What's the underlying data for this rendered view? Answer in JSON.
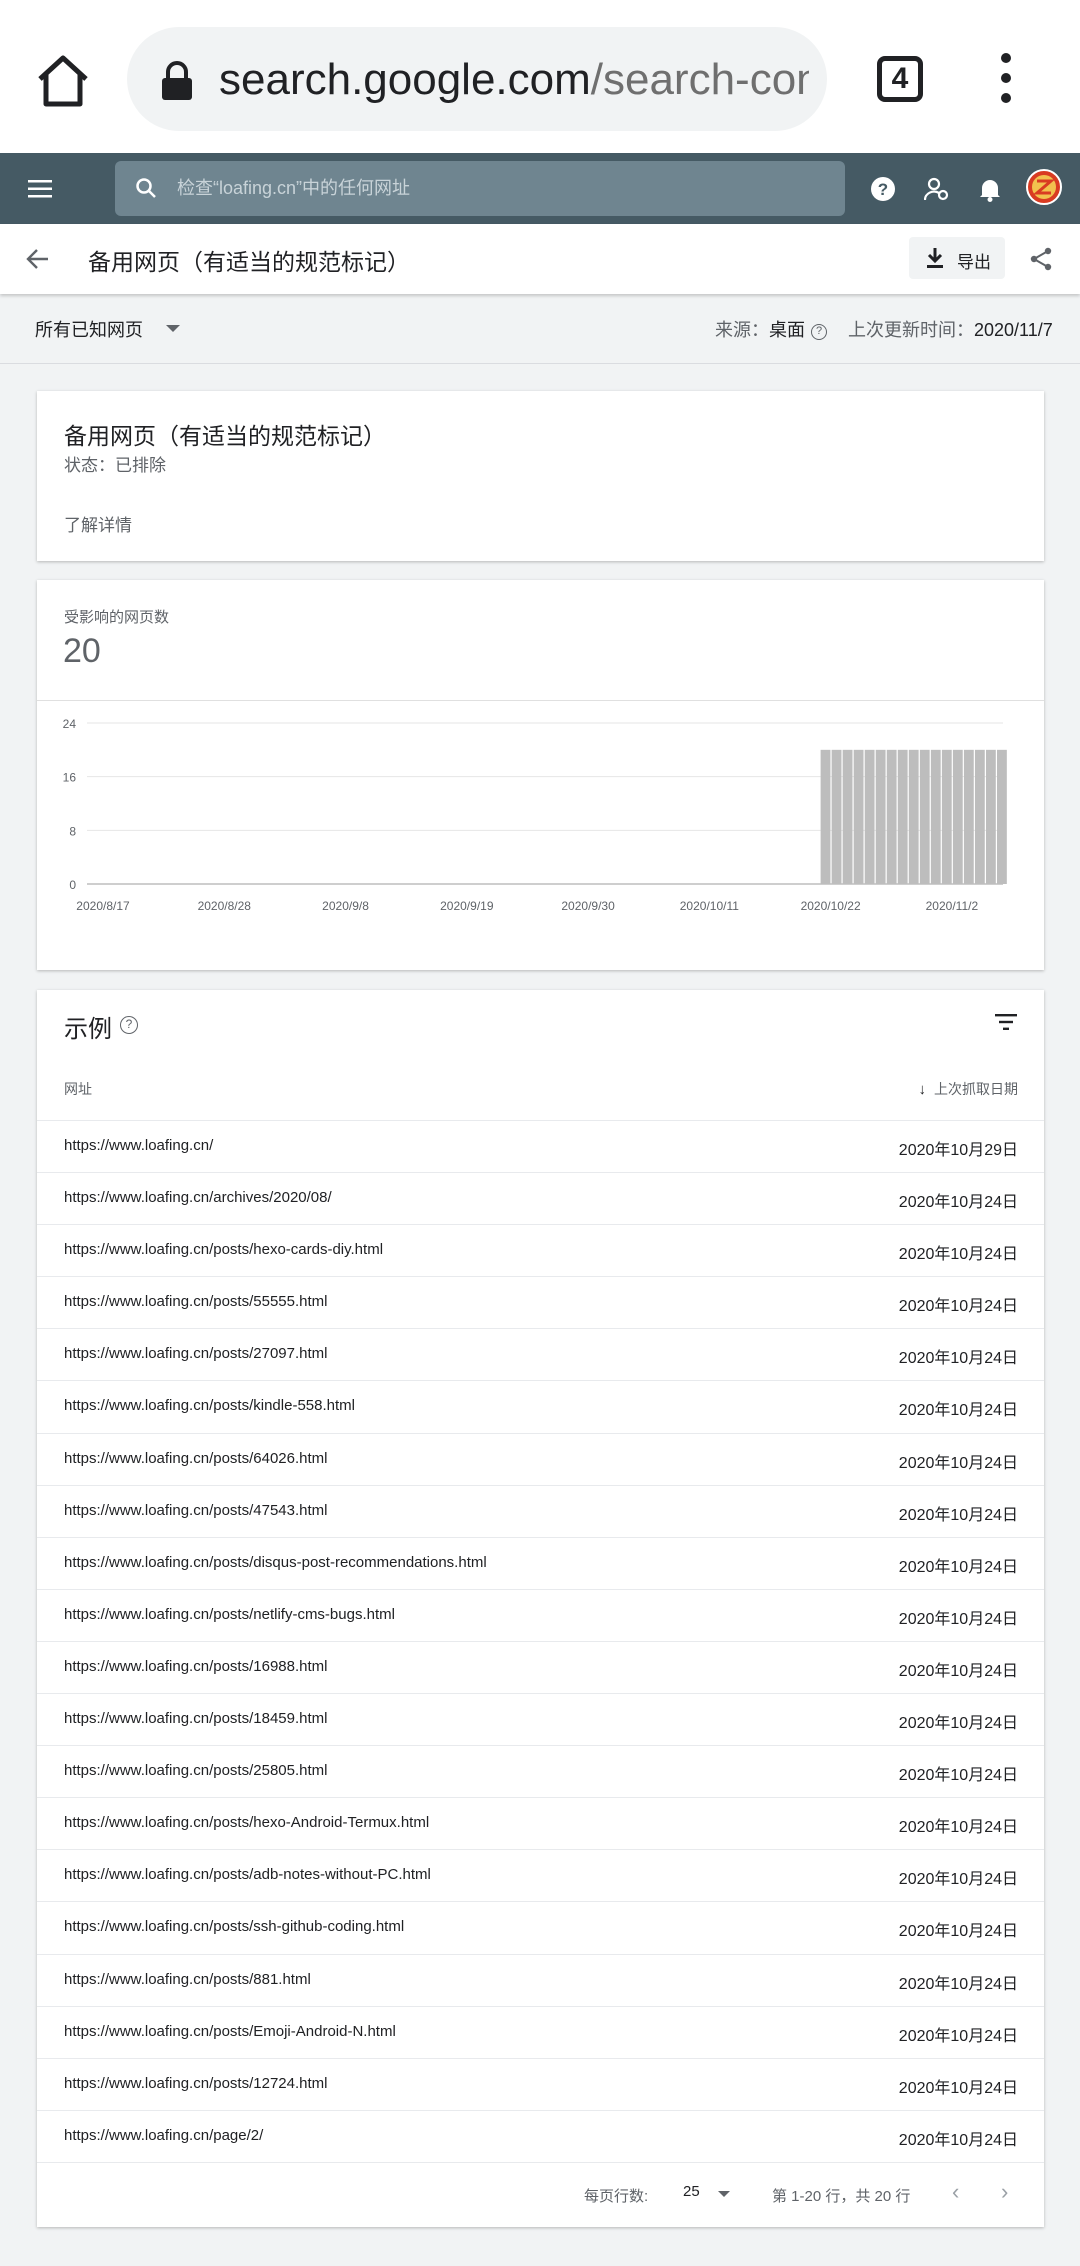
{
  "browser": {
    "url_host": "search.google.com",
    "url_rest": "/search-cons",
    "tab_count": "4"
  },
  "app": {
    "search_placeholder": "检查“loafing.cn”中的任何网址"
  },
  "page": {
    "title": "备用网页（有适当的规范标记）",
    "export_label": "导出"
  },
  "filters": {
    "scope": "所有已知网页",
    "source_label": "来源：",
    "source_value": "桌面",
    "updated_label": "上次更新时间：",
    "updated_value": "2020/11/7"
  },
  "status_card": {
    "title": "备用网页（有适当的规范标记）",
    "status": "状态：已排除",
    "learn_more": "了解详情"
  },
  "kpi": {
    "label": "受影响的网页数",
    "value": "20"
  },
  "chart_data": {
    "type": "bar",
    "ylim": [
      0,
      24
    ],
    "yticks": [
      "24",
      "16",
      "8",
      "0"
    ],
    "xticks": [
      "2020/8/17",
      "2020/8/28",
      "2020/9/8",
      "2020/9/19",
      "2020/9/30",
      "2020/10/11",
      "2020/10/22",
      "2020/11/2"
    ],
    "x_start": "2020/8/17",
    "x_end": "2020/11/7",
    "bars_from": "2020/10/22",
    "values": [
      20,
      20,
      20,
      20,
      20,
      20,
      20,
      20,
      20,
      20,
      20,
      20,
      20,
      20,
      20,
      20,
      20
    ],
    "bar_color": "#bdbdbd",
    "grid": true
  },
  "examples": {
    "title": "示例",
    "col_url": "网址",
    "col_date": "上次抓取日期",
    "rows": [
      {
        "url": "https://www.loafing.cn/",
        "date": "2020年10月29日"
      },
      {
        "url": "https://www.loafing.cn/archives/2020/08/",
        "date": "2020年10月24日"
      },
      {
        "url": "https://www.loafing.cn/posts/hexo-cards-diy.html",
        "date": "2020年10月24日"
      },
      {
        "url": "https://www.loafing.cn/posts/55555.html",
        "date": "2020年10月24日"
      },
      {
        "url": "https://www.loafing.cn/posts/27097.html",
        "date": "2020年10月24日"
      },
      {
        "url": "https://www.loafing.cn/posts/kindle-558.html",
        "date": "2020年10月24日"
      },
      {
        "url": "https://www.loafing.cn/posts/64026.html",
        "date": "2020年10月24日"
      },
      {
        "url": "https://www.loafing.cn/posts/47543.html",
        "date": "2020年10月24日"
      },
      {
        "url": "https://www.loafing.cn/posts/disqus-post-recommendations.html",
        "date": "2020年10月24日"
      },
      {
        "url": "https://www.loafing.cn/posts/netlify-cms-bugs.html",
        "date": "2020年10月24日"
      },
      {
        "url": "https://www.loafing.cn/posts/16988.html",
        "date": "2020年10月24日"
      },
      {
        "url": "https://www.loafing.cn/posts/18459.html",
        "date": "2020年10月24日"
      },
      {
        "url": "https://www.loafing.cn/posts/25805.html",
        "date": "2020年10月24日"
      },
      {
        "url": "https://www.loafing.cn/posts/hexo-Android-Termux.html",
        "date": "2020年10月24日"
      },
      {
        "url": "https://www.loafing.cn/posts/adb-notes-without-PC.html",
        "date": "2020年10月24日"
      },
      {
        "url": "https://www.loafing.cn/posts/ssh-github-coding.html",
        "date": "2020年10月24日"
      },
      {
        "url": "https://www.loafing.cn/posts/881.html",
        "date": "2020年10月24日"
      },
      {
        "url": "https://www.loafing.cn/posts/Emoji-Android-N.html",
        "date": "2020年10月24日"
      },
      {
        "url": "https://www.loafing.cn/posts/12724.html",
        "date": "2020年10月24日"
      },
      {
        "url": "https://www.loafing.cn/page/2/",
        "date": "2020年10月24日"
      }
    ]
  },
  "pager": {
    "rows_per_page_label": "每页行数:",
    "rows_per_page": "25",
    "range": "第 1-20 行，共 20 行"
  },
  "colors": {
    "header_bg": "#455a64",
    "search_bg": "#6f8590",
    "bar": "#bdbdbd"
  }
}
